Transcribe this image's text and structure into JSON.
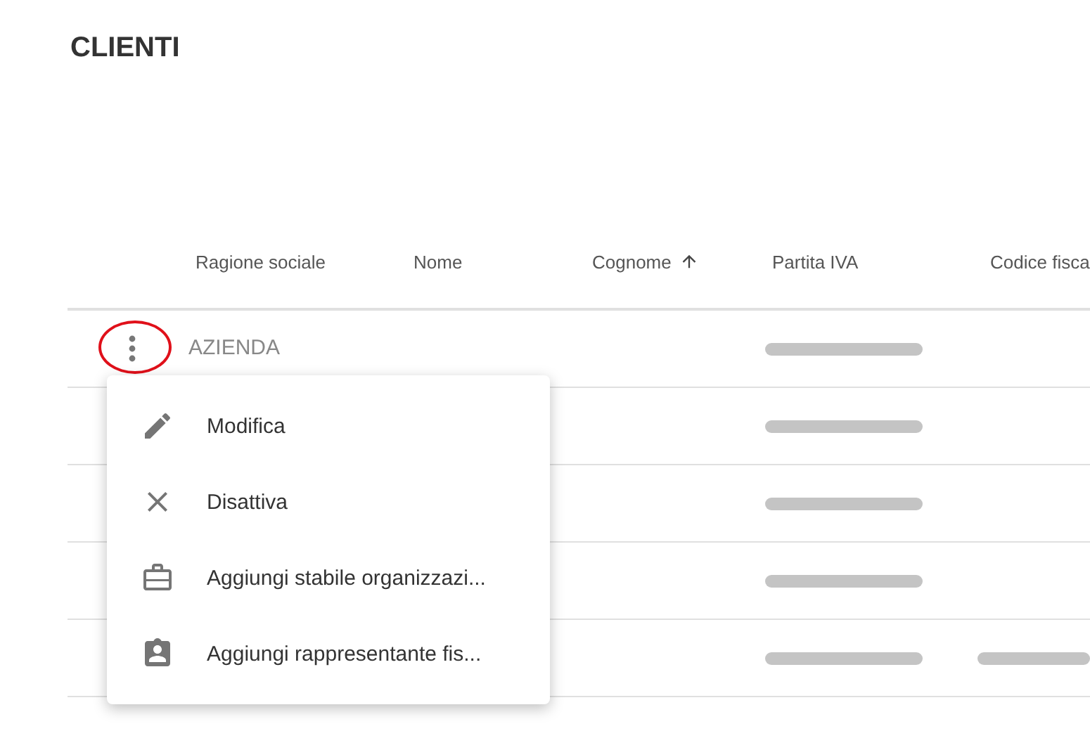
{
  "title": "CLIENTI",
  "table": {
    "columns": [
      {
        "label": "Ragione sociale"
      },
      {
        "label": "Nome"
      },
      {
        "label": "Cognome",
        "sort_ascending": true
      },
      {
        "label": "Partita IVA"
      },
      {
        "label": "Codice fisca"
      }
    ],
    "rows": [
      {
        "menu_highlighted": true,
        "ragione_sociale": "AZIENDA",
        "partita_iva_redacted": true
      },
      {
        "partita_iva_redacted": true
      },
      {
        "partita_iva_redacted": true
      },
      {
        "partita_iva_redacted": true
      },
      {
        "partita_iva_redacted": true,
        "codice_fiscale_redacted": true
      }
    ]
  },
  "menu": {
    "items": [
      {
        "kind": "edit",
        "label": "Modifica"
      },
      {
        "kind": "close",
        "label": "Disattiva"
      },
      {
        "kind": "briefcase",
        "label": "Aggiungi stabile organizzazi..."
      },
      {
        "kind": "badge",
        "label": "Aggiungi rappresentante fis..."
      }
    ]
  }
}
